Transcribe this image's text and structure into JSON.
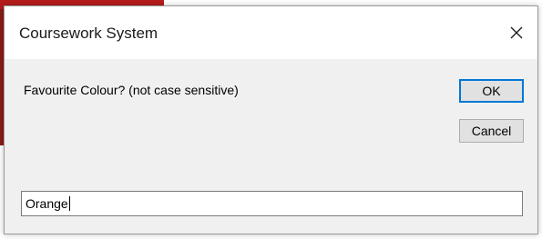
{
  "dialog": {
    "title": "Coursework System",
    "prompt": "Favourite Colour? (not case sensitive)",
    "ok_label": "OK",
    "cancel_label": "Cancel",
    "input_value": "Orange",
    "close_icon": "close-icon"
  },
  "colors": {
    "accent_border": "#0078d7",
    "backdrop_accent": "#b51c1c"
  }
}
